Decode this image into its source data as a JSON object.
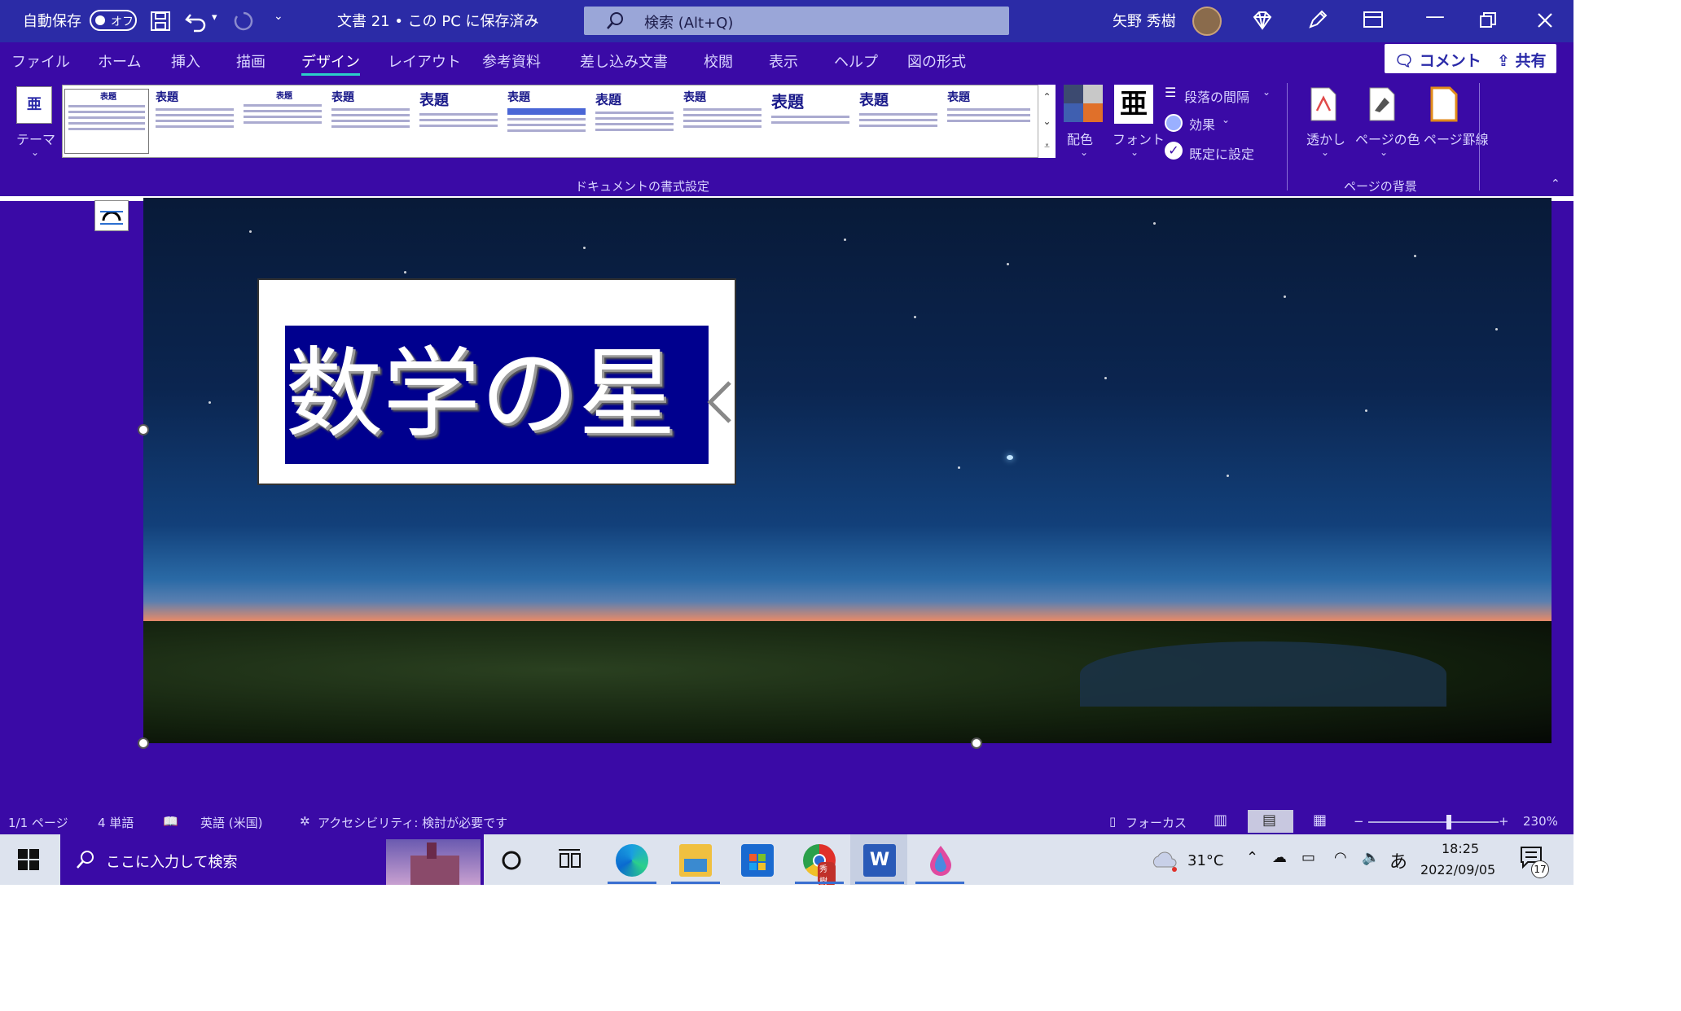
{
  "titlebar": {
    "autosave_label": "自動保存",
    "autosave_state": "オフ",
    "doc_title": "文書 21 • この PC に保存済み",
    "search_placeholder": "検索 (Alt+Q)",
    "user_name": "矢野 秀樹"
  },
  "tabs": [
    "ファイル",
    "ホーム",
    "挿入",
    "描画",
    "デザイン",
    "レイアウト",
    "参考資料",
    "差し込み文書",
    "校閲",
    "表示",
    "ヘルプ",
    "図の形式"
  ],
  "active_tab": "デザイン",
  "top_buttons": {
    "comment": "コメント",
    "share": "共有"
  },
  "ribbon": {
    "theme_label": "テーマ",
    "gallery_headings": [
      "表題",
      "表題",
      "表題",
      "表題",
      "表題",
      "表題",
      "表題",
      "表題",
      "表題",
      "表題",
      "表題"
    ],
    "group_document_format": "ドキュメントの書式設定",
    "colors_label": "配色",
    "fonts_label": "フォント",
    "paragraph_spacing": "段落の間隔",
    "effects": "効果",
    "set_default": "既定に設定",
    "watermark": "透かし",
    "page_color": "ページの色",
    "page_borders": "ページ罫線",
    "group_page_background": "ページの背景"
  },
  "document": {
    "title_text": "数学の星"
  },
  "statusbar": {
    "page": "1/1 ページ",
    "words": "4 単語",
    "language": "英語 (米国)",
    "accessibility": "アクセシビリティ: 検討が必要です",
    "focus": "フォーカス",
    "zoom": "230%"
  },
  "taskbar": {
    "search_placeholder": "ここに入力して検索",
    "weather": "31°C",
    "ime": "あ",
    "time": "18:25",
    "date": "2022/09/05",
    "notifications": "17",
    "chrome_badge": "秀樹"
  },
  "colors": {
    "app_background": "#3a0aa6",
    "titlebar": "#2b2ba6",
    "title_fill": "#00008e",
    "active_tab_underline": "#2bd0c8"
  }
}
